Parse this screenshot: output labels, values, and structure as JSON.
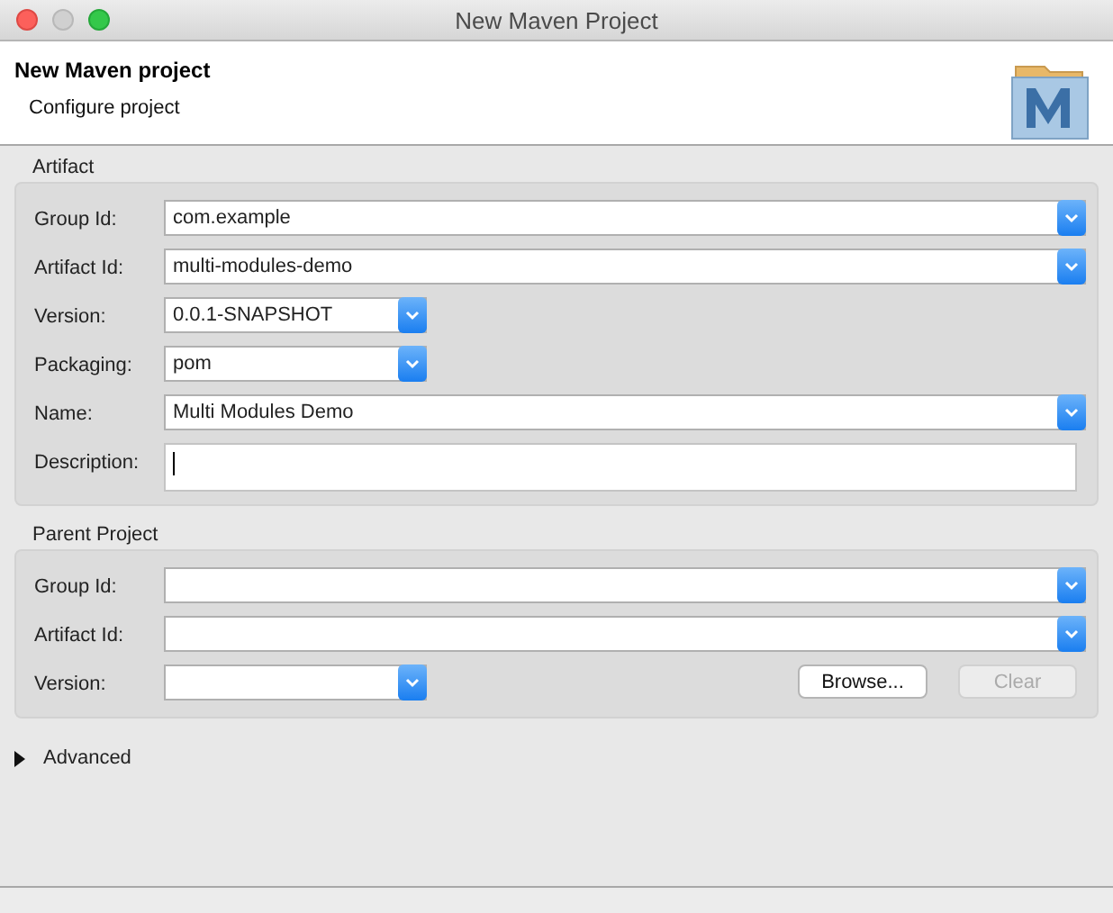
{
  "window": {
    "title": "New Maven Project"
  },
  "header": {
    "title": "New Maven project",
    "subtitle": "Configure project"
  },
  "artifact": {
    "title": "Artifact",
    "fields": [
      {
        "label": "Group Id:",
        "kind": "combo",
        "value": "com.example"
      },
      {
        "label": "Artifact Id:",
        "kind": "combo",
        "value": "multi-modules-demo"
      },
      {
        "label": "Version:",
        "kind": "short-combo",
        "value": "0.0.1-SNAPSHOT"
      },
      {
        "label": "Packaging:",
        "kind": "short-combo",
        "value": "pom"
      },
      {
        "label": "Name:",
        "kind": "combo",
        "value": "Multi Modules Demo"
      },
      {
        "label": "Description:",
        "kind": "textarea"
      }
    ]
  },
  "parent": {
    "title": "Parent Project",
    "fields": [
      {
        "label": "Group Id:",
        "kind": "combo"
      },
      {
        "label": "Artifact Id:",
        "kind": "combo"
      },
      {
        "label": "Version:",
        "kind": "short-combo"
      }
    ],
    "buttons": [
      {
        "label": "Browse...",
        "disabled": false
      },
      {
        "label": "Clear",
        "disabled": true
      }
    ]
  },
  "advanced": {
    "label": "Advanced",
    "expanded": false
  }
}
